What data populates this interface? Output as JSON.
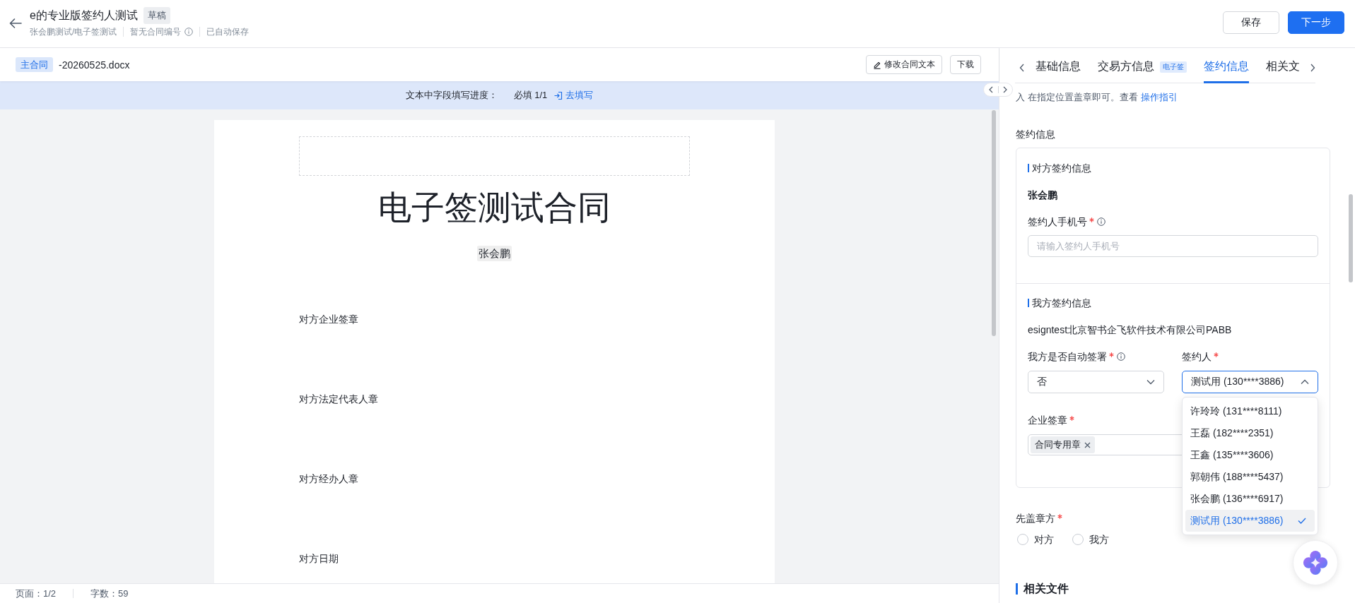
{
  "header": {
    "title": "e的专业版签约人测试",
    "status_badge": "草稿",
    "breadcrumb": "张会鹏测试/电子签测试",
    "contract_number": "暂无合同编号",
    "save_state": "已自动保存",
    "buttons": [
      {
        "label": "保存",
        "kind": "secondary"
      },
      {
        "label": "下一步",
        "kind": "primary"
      }
    ]
  },
  "document": {
    "tag": "主合同",
    "file_name": "-20260525.docx",
    "actions": [
      {
        "label": "修改合同文本",
        "kind": "edit"
      },
      {
        "label": "下载",
        "kind": "plain"
      }
    ],
    "progress": {
      "label": "文本中字段填写进度：",
      "required": "必填 1/1",
      "link": "去填写"
    },
    "page": {
      "title": "电子签测试合同",
      "party": "张会鹏",
      "fields": [
        "对方企业签章",
        "对方法定代表人章",
        "对方经办人章",
        "对方日期"
      ]
    }
  },
  "status_bar": {
    "page": "页面：1/2",
    "word_count": "字数：59"
  },
  "panel": {
    "tabs": [
      {
        "label": "基础信息",
        "selected": false
      },
      {
        "label": "交易方信息",
        "badge": "电子签",
        "selected": false
      },
      {
        "label": "签约信息",
        "selected": true
      },
      {
        "label": "相关文",
        "selected": false
      }
    ],
    "hint": {
      "text": "入 在指定位置盖章即可。查看",
      "link": "操作指引"
    },
    "section_title": "签约信息",
    "counterparty": {
      "heading": "对方签约信息",
      "name": "张会鹏",
      "phone_field": {
        "label": "签约人手机号",
        "required": true,
        "placeholder": "请输入签约人手机号"
      }
    },
    "our_side": {
      "heading": "我方签约信息",
      "company": "esigntest北京智书企飞软件技术有限公司PABB",
      "auto_sign": {
        "label": "我方是否自动签署",
        "required": true,
        "value": "否",
        "expanded": false
      },
      "signer": {
        "label": "签约人",
        "required": true,
        "value": "测试用 (130****3886)",
        "expanded": true,
        "options": [
          {
            "label": "许玲玲 (131****8111)",
            "selected": false
          },
          {
            "label": "王磊 (182****2351)",
            "selected": false
          },
          {
            "label": "王鑫 (135****3606)",
            "selected": false
          },
          {
            "label": "郭朝伟 (188****5437)",
            "selected": false
          },
          {
            "label": "张会鹏 (136****6917)",
            "selected": false
          },
          {
            "label": "测试用 (130****3886)",
            "selected": true
          }
        ]
      },
      "seal": {
        "label": "企业签章",
        "required": true,
        "tags": [
          "合同专用章"
        ]
      }
    },
    "first_sealer": {
      "label": "先盖章方",
      "required": true,
      "options": [
        {
          "label": "对方",
          "selected": false
        },
        {
          "label": "我方",
          "selected": false
        }
      ]
    },
    "related_files": {
      "heading": "相关文件"
    }
  }
}
